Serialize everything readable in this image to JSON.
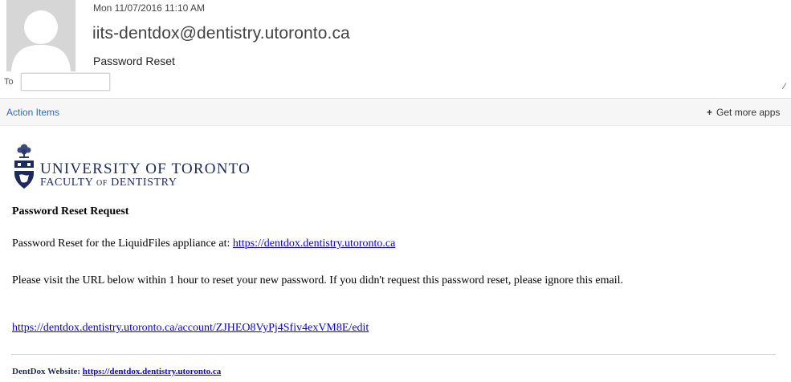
{
  "header": {
    "datetime": "Mon 11/07/2016 11:10 AM",
    "sender": "iits-dentdox@dentistry.utoronto.ca",
    "subject": "Password Reset",
    "to_label": "To",
    "to_value": ""
  },
  "actionbar": {
    "action_items_label": "Action Items",
    "get_apps_label": "Get more apps",
    "plus_glyph": "+"
  },
  "body": {
    "logo": {
      "university": "UNIVERSITY OF TORONTO",
      "faculty_prefix": "FACULTY",
      "faculty_of": "OF",
      "faculty_suffix": "DENTISTRY"
    },
    "heading": "Password Reset Request",
    "line1_text": "Password Reset for the LiquidFiles appliance at:",
    "line1_link": "https://dentdox.dentistry.utoronto.ca",
    "line2_text": "Please visit the URL below within 1 hour to reset your new password. If you didn't request this password reset, please ignore this email.",
    "reset_url": "https://dentdox.dentistry.utoronto.ca/account/ZJHEO8VyPj4Sfiv4exVM8E/edit",
    "footer_label": "DentDox Website:",
    "footer_link": "https://dentdox.dentistry.utoronto.ca"
  },
  "colors": {
    "link": "#0b00d9",
    "action_items": "#2a6ebb",
    "brand_navy": "#1e2a5a"
  }
}
